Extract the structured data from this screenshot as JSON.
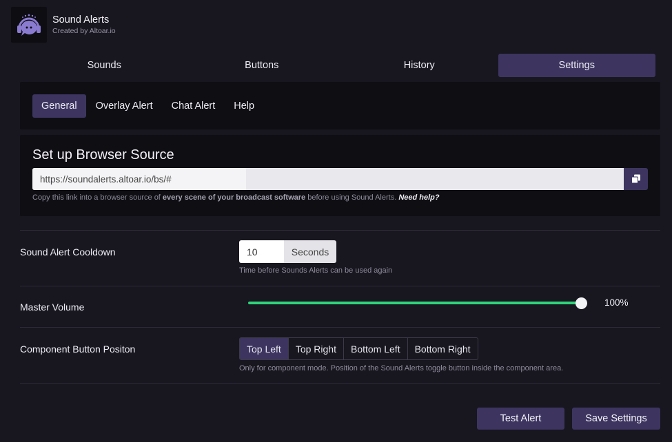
{
  "app": {
    "title": "Sound Alerts",
    "subtitle": "Created by Altoar.io",
    "logo_icon": "speech-bubble-headset-icon"
  },
  "tabs": [
    {
      "label": "Sounds",
      "active": false
    },
    {
      "label": "Buttons",
      "active": false
    },
    {
      "label": "History",
      "active": false
    },
    {
      "label": "Settings",
      "active": true
    }
  ],
  "subtabs": [
    {
      "label": "General",
      "active": true
    },
    {
      "label": "Overlay Alert",
      "active": false
    },
    {
      "label": "Chat Alert",
      "active": false
    },
    {
      "label": "Help",
      "active": false
    }
  ],
  "browser_source": {
    "title": "Set up Browser Source",
    "url": "https://soundalerts.altoar.io/bs/#",
    "copy_icon": "copy-icon",
    "hint_prefix": "Copy this link into a browser source of ",
    "hint_bold": "every scene of your broadcast software",
    "hint_middle": " before using Sound Alerts. ",
    "hint_link": "Need help?"
  },
  "cooldown": {
    "label": "Sound Alert Cooldown",
    "value": "10",
    "unit": "Seconds",
    "hint": "Time before Sounds Alerts can be used again"
  },
  "volume": {
    "label": "Master Volume",
    "value_text": "100%",
    "level": 1.0
  },
  "position": {
    "label": "Component Button Positon",
    "options": [
      "Top Left",
      "Top Right",
      "Bottom Left",
      "Bottom Right"
    ],
    "selected": "Top Left",
    "hint": "Only for component mode. Position of the Sound Alerts toggle button inside the component area."
  },
  "actions": {
    "test_label": "Test Alert",
    "save_label": "Save Settings"
  },
  "colors": {
    "background": "#18161f",
    "card": "#0f0e13",
    "accent": "#3d3560",
    "slider": "#2fd47a"
  }
}
